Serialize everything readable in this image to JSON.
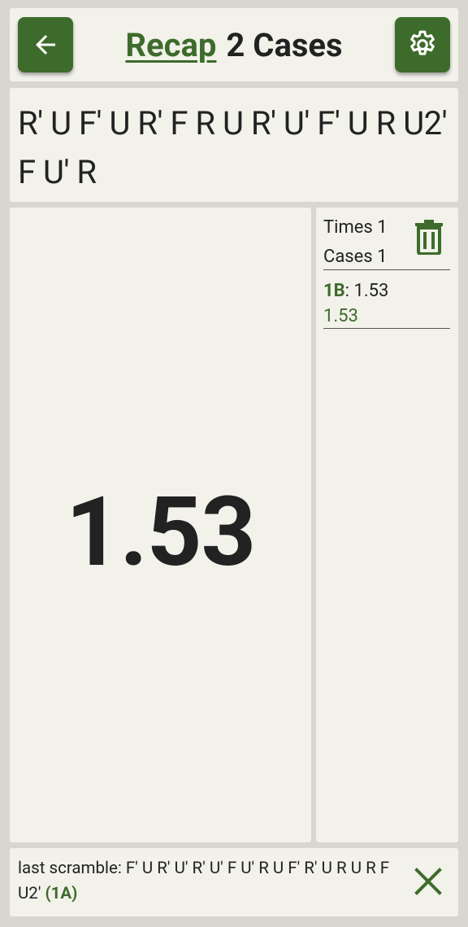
{
  "header": {
    "title_link": "Recap",
    "title_rest": "2 Cases",
    "back_icon": "arrow-left-icon",
    "settings_icon": "gear-icon"
  },
  "scramble": {
    "text": "R' U F' U R' F R U R' U' F' U R U2' F U' R"
  },
  "timer": {
    "value": "1.53"
  },
  "stats": {
    "times_label": "Times 1",
    "cases_label": "Cases 1",
    "trash_icon": "trash-icon",
    "entries": [
      {
        "case": "1B",
        "separator": ": ",
        "time": "1.53",
        "average": "1.53"
      }
    ]
  },
  "last_scramble": {
    "prefix": "last scramble: ",
    "text": "F' U R' U' R' U' F U' R U F' R' U R U R F U2' ",
    "case": "(1A)",
    "close_icon": "close-icon"
  },
  "colors": {
    "accent": "#3d6b2b",
    "panel_bg": "#f2f1ea",
    "page_bg": "#d8d6cf",
    "text": "#222222"
  }
}
